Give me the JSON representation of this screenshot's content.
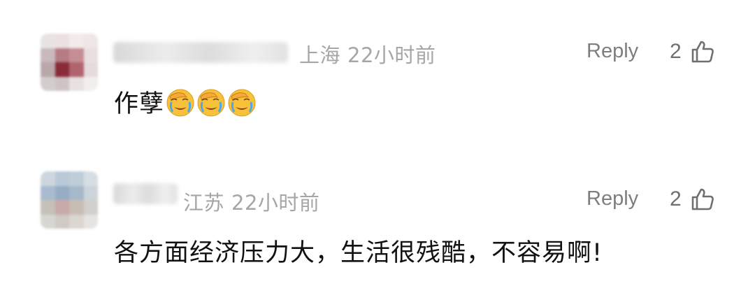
{
  "comments": [
    {
      "location": "上海",
      "time": "22小时前",
      "reply_label": "Reply",
      "likes": "2",
      "text": "作孽",
      "emoji_icons": [
        "face-palm-crying-icon",
        "face-palm-crying-icon",
        "face-palm-crying-icon"
      ]
    },
    {
      "location": "江苏",
      "time": "22小时前",
      "reply_label": "Reply",
      "likes": "2",
      "text": "各方面经济压力大，生活很残酷，不容易啊!"
    }
  ],
  "icons": {
    "like": "thumbs-up-outline-icon"
  },
  "colors": {
    "meta": "#a6a6a6",
    "reply": "#7e7e7e",
    "text": "#111111"
  }
}
